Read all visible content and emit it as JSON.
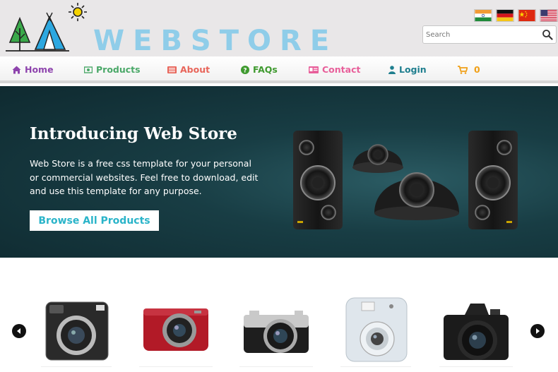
{
  "header": {
    "logo_text": "WEBSTORE",
    "search": {
      "placeholder": "Search"
    },
    "flags": [
      "india-flag",
      "germany-flag",
      "china-flag",
      "usa-flag"
    ]
  },
  "nav": {
    "items": [
      {
        "label": "Home",
        "icon": "home-icon",
        "color": "#8e44ad"
      },
      {
        "label": "Products",
        "icon": "money-icon",
        "color": "#4aa868"
      },
      {
        "label": "About",
        "icon": "list-icon",
        "color": "#e8655a"
      },
      {
        "label": "FAQs",
        "icon": "question-icon",
        "color": "#3f9a2f"
      },
      {
        "label": "Contact",
        "icon": "id-card-icon",
        "color": "#e85f9a"
      },
      {
        "label": "Login",
        "icon": "user-icon",
        "color": "#1e7e8e"
      },
      {
        "label": "0",
        "icon": "cart-icon",
        "color": "#f0a018"
      }
    ]
  },
  "hero": {
    "title": "Introducing Web Store",
    "description": "Web Store is a free css template for your personal or commercial websites. Feel free to download, edit and use this template for any purpose.",
    "button_label": "Browse All Products"
  },
  "colors": {
    "accent": "#2ab4c9",
    "logo": "#8fcde9",
    "hero_bg": "#183d44"
  },
  "products": {
    "items": [
      "instant-camera-square",
      "red-compact-camera",
      "mirrorless-camera-retro",
      "instant-camera-white",
      "black-dslr-camera"
    ]
  }
}
